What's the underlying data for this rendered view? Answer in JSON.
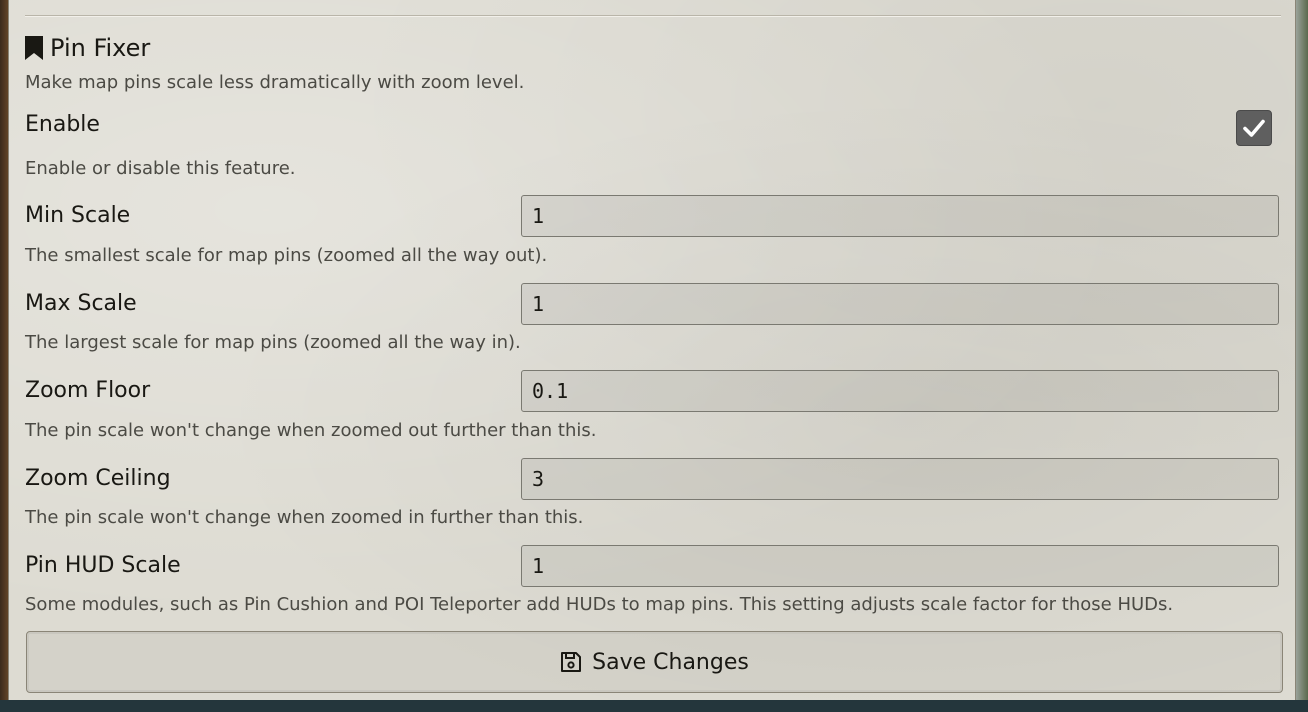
{
  "section": {
    "title": "Pin Fixer",
    "description": "Make map pins scale less dramatically with zoom level."
  },
  "settings": {
    "enable": {
      "label": "Enable",
      "hint": "Enable or disable this feature.",
      "checked": true
    },
    "min_scale": {
      "label": "Min Scale",
      "value": "1",
      "hint": "The smallest scale for map pins (zoomed all the way out)."
    },
    "max_scale": {
      "label": "Max Scale",
      "value": "1",
      "hint": "The largest scale for map pins (zoomed all the way in)."
    },
    "zoom_floor": {
      "label": "Zoom Floor",
      "value": "0.1",
      "hint": "The pin scale won't change when zoomed out further than this."
    },
    "zoom_ceiling": {
      "label": "Zoom Ceiling",
      "value": "3",
      "hint": "The pin scale won't change when zoomed in further than this."
    },
    "pin_hud_scale": {
      "label": "Pin HUD Scale",
      "value": "1",
      "hint": "Some modules, such as Pin Cushion and POI Teleporter add HUDs to map pins. This setting adjusts scale factor for those HUDs."
    }
  },
  "footer": {
    "save_label": "Save Changes",
    "save_icon": "floppy-disk-icon"
  },
  "icons": {
    "section_icon": "bookmark-icon",
    "checkbox_icon": "checkmark-icon"
  },
  "colors": {
    "panel_background": "#dddbd2",
    "text_primary": "#191813",
    "text_hint": "#4b4a44",
    "checkbox_fill": "#5f5f5f",
    "field_border": "#7a7971"
  }
}
